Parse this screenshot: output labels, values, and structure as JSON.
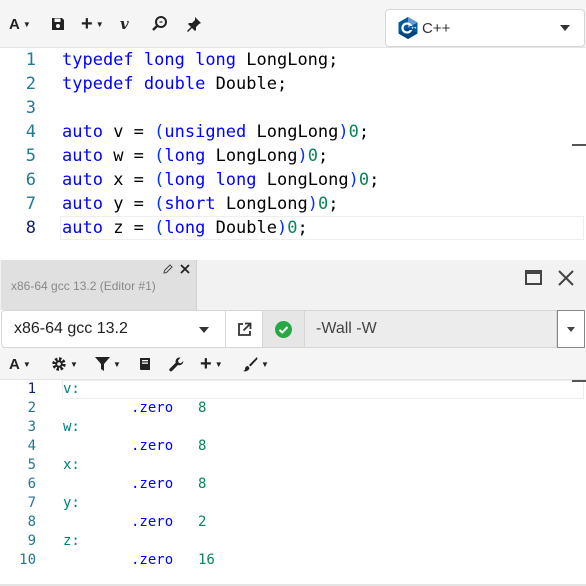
{
  "top_toolbar": {
    "font_button_label": "A",
    "save_icon": "save-icon",
    "add_button_label": "+",
    "vim_label": "v",
    "search_icon": "search-icon",
    "pin_icon": "pin-icon",
    "language": {
      "name": "C++",
      "logo": "cpp-logo-icon"
    }
  },
  "source": {
    "lines": [
      {
        "n": "1",
        "tokens": [
          {
            "t": "typedef",
            "c": "kw"
          },
          {
            "t": " ",
            "c": "plain"
          },
          {
            "t": "long long",
            "c": "kw"
          },
          {
            "t": " LongLong;",
            "c": "plain"
          }
        ]
      },
      {
        "n": "2",
        "tokens": [
          {
            "t": "typedef",
            "c": "kw"
          },
          {
            "t": " ",
            "c": "plain"
          },
          {
            "t": "double",
            "c": "kw"
          },
          {
            "t": " Double;",
            "c": "plain"
          }
        ]
      },
      {
        "n": "3",
        "tokens": []
      },
      {
        "n": "4",
        "tokens": [
          {
            "t": "auto",
            "c": "kw"
          },
          {
            "t": " v = ",
            "c": "plain"
          },
          {
            "t": "(",
            "c": "paren"
          },
          {
            "t": "unsigned",
            "c": "kw"
          },
          {
            "t": " LongLong",
            "c": "plain"
          },
          {
            "t": ")",
            "c": "paren"
          },
          {
            "t": "0",
            "c": "num"
          },
          {
            "t": ";",
            "c": "plain"
          }
        ]
      },
      {
        "n": "5",
        "tokens": [
          {
            "t": "auto",
            "c": "kw"
          },
          {
            "t": " w = ",
            "c": "plain"
          },
          {
            "t": "(",
            "c": "paren"
          },
          {
            "t": "long",
            "c": "kw"
          },
          {
            "t": " LongLong",
            "c": "plain"
          },
          {
            "t": ")",
            "c": "paren"
          },
          {
            "t": "0",
            "c": "num"
          },
          {
            "t": ";",
            "c": "plain"
          }
        ]
      },
      {
        "n": "6",
        "tokens": [
          {
            "t": "auto",
            "c": "kw"
          },
          {
            "t": " x = ",
            "c": "plain"
          },
          {
            "t": "(",
            "c": "paren"
          },
          {
            "t": "long long",
            "c": "kw"
          },
          {
            "t": " LongLong",
            "c": "plain"
          },
          {
            "t": ")",
            "c": "paren"
          },
          {
            "t": "0",
            "c": "num"
          },
          {
            "t": ";",
            "c": "plain"
          }
        ]
      },
      {
        "n": "7",
        "tokens": [
          {
            "t": "auto",
            "c": "kw"
          },
          {
            "t": " y = ",
            "c": "plain"
          },
          {
            "t": "(",
            "c": "paren"
          },
          {
            "t": "short",
            "c": "kw"
          },
          {
            "t": " LongLong",
            "c": "plain"
          },
          {
            "t": ")",
            "c": "paren"
          },
          {
            "t": "0",
            "c": "num"
          },
          {
            "t": ";",
            "c": "plain"
          }
        ]
      },
      {
        "n": "8",
        "active": true,
        "tokens": [
          {
            "t": "auto",
            "c": "kw"
          },
          {
            "t": " z = ",
            "c": "plain"
          },
          {
            "t": "(",
            "c": "paren"
          },
          {
            "t": "long",
            "c": "kw"
          },
          {
            "t": " Double",
            "c": "plain"
          },
          {
            "t": ")",
            "c": "paren"
          },
          {
            "t": "0",
            "c": "num"
          },
          {
            "t": ";",
            "c": "plain"
          }
        ]
      }
    ]
  },
  "compiler_pane": {
    "tab_title": "x86-64 gcc 13.2 (Editor #1)",
    "compiler_name": "x86-64 gcc 13.2",
    "flags_value": "-Wall -W",
    "status": "success",
    "out_font_label": "A",
    "out_add_label": "+"
  },
  "assembly": {
    "lines": [
      {
        "n": "1",
        "label": "v:",
        "active": true
      },
      {
        "n": "2",
        "dir": ".zero",
        "val": "8"
      },
      {
        "n": "3",
        "label": "w:"
      },
      {
        "n": "4",
        "dir": ".zero",
        "val": "8"
      },
      {
        "n": "5",
        "label": "x:"
      },
      {
        "n": "6",
        "dir": ".zero",
        "val": "8"
      },
      {
        "n": "7",
        "label": "y:"
      },
      {
        "n": "8",
        "dir": ".zero",
        "val": "2"
      },
      {
        "n": "9",
        "label": "z:"
      },
      {
        "n": "10",
        "dir": ".zero",
        "val": "16"
      }
    ]
  },
  "colors": {
    "keyword": "#0000ff",
    "number": "#098658",
    "paren": "#0431fa",
    "asm_label": "#008080",
    "line_number": "#237893",
    "success": "#28a745"
  }
}
